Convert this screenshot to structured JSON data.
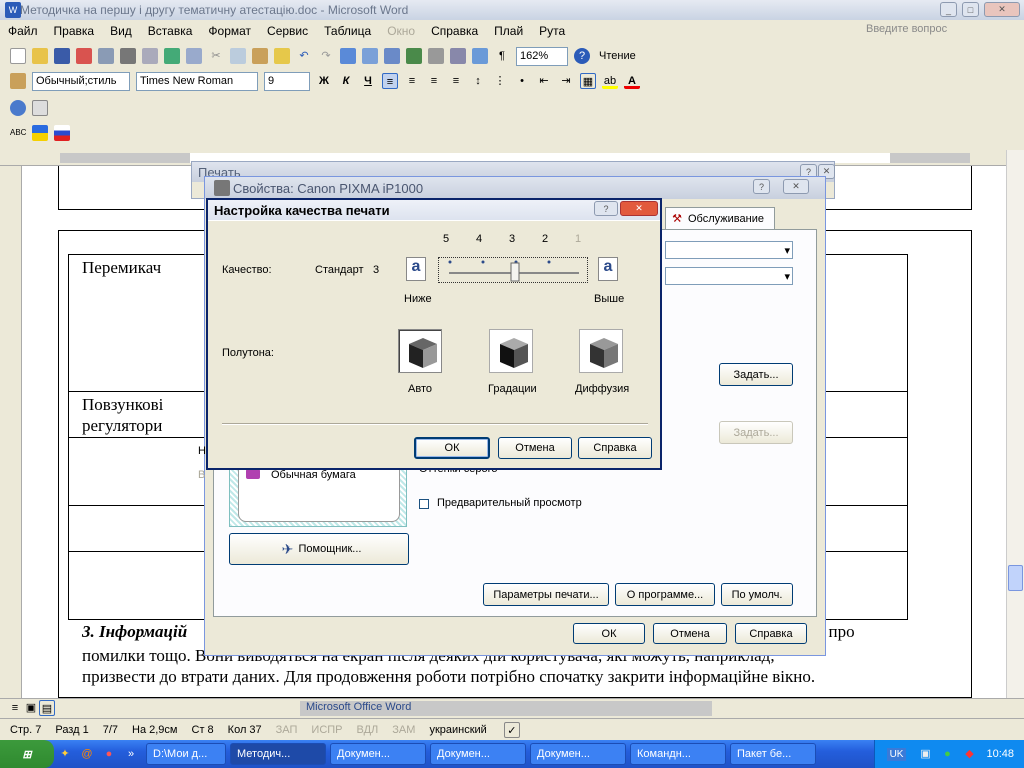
{
  "window": {
    "title": "Методичка на першу і другу тематичну атестацію.doc - Microsoft Word"
  },
  "menu": {
    "items": [
      "Файл",
      "Правка",
      "Вид",
      "Вставка",
      "Формат",
      "Сервис",
      "Таблица",
      "Окно",
      "Справка",
      "Плай",
      "Рута"
    ],
    "help_placeholder": "Введите вопрос"
  },
  "toolbar": {
    "zoom": "162%",
    "reading": "Чтение",
    "style": "Обычный;стиль",
    "font": "Times New Roman",
    "size": "9"
  },
  "document": {
    "row1": "Перемикач",
    "row2": "Повзункові регулятори",
    "para_bold": "3. Інформацій",
    "para_end": ", про",
    "line2": "помилки тощо. Вони виводяться на екран після деяких дій користувача, які можуть, наприклад,",
    "line3": "призвести до втрати даних. Для продовження роботи потрібно спочатку закрити інформаційне вікно.",
    "popup": "Microsoft Office Word"
  },
  "print_dialog": {
    "title": "Печать"
  },
  "props_dialog": {
    "title": "Свойства: Canon PIXMA iP1000",
    "tab_service": "Обслуживание",
    "set_button": "Задать...",
    "set_button2": "Задать...",
    "paper": "Обычная бумага",
    "grayscale": "Оттенки серого",
    "preview": "Предварительный просмотр",
    "assistant": "Помощник...",
    "print_params": "Параметры печати...",
    "about": "О программе...",
    "defaults": "По умолч.",
    "ok": "ОК",
    "cancel": "Отмена",
    "help": "Справка",
    "clip_h": "Н",
    "clip_b": "В"
  },
  "quality_dialog": {
    "title": "Настройка качества печати",
    "quality_label": "Качество:",
    "quality_value": "Стандарт",
    "quality_num": "3",
    "scale": [
      "5",
      "4",
      "3",
      "2",
      "1"
    ],
    "lower": "Ниже",
    "higher": "Выше",
    "slider_level": "3",
    "halftone_label": "Полутона:",
    "halftones": [
      "Авто",
      "Градации",
      "Диффузия"
    ],
    "ok": "ОК",
    "cancel": "Отмена",
    "help": "Справка"
  },
  "status": {
    "page": "Стр. 7",
    "section": "Разд 1",
    "pages": "7/7",
    "at": "На 2,9см",
    "line": "Ст 8",
    "col": "Кол 37",
    "rec": "ЗАП",
    "trk": "ИСПР",
    "ext": "ВДЛ",
    "ovr": "ЗАМ",
    "lang": "украинский"
  },
  "taskbar": {
    "items": [
      "D:\\Мои д...",
      "Методич...",
      "Докумен...",
      "Докумен...",
      "Докумен...",
      "Командн...",
      "Пакет бе..."
    ],
    "lang": "UK",
    "time": "10:48"
  },
  "colors": {
    "accent": "#245edc",
    "xp_border": "#003c74",
    "dialog_bg": "#ece9d8"
  }
}
